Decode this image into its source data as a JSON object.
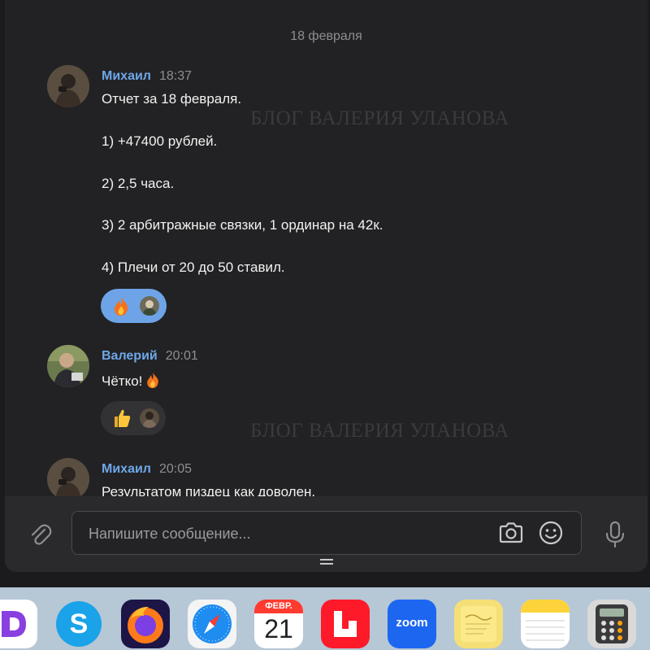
{
  "date_separator": "18 февраля",
  "messages": [
    {
      "author": "Михаил",
      "time": "18:37",
      "lines": [
        "Отчет за 18 февраля.",
        "1) +47400 рублей.",
        "2) 2,5 часа.",
        "3) 2 арбитражные связки, 1 ординар на 42к.",
        "4) Плечи от 20 до 50 ставил."
      ],
      "reaction": "fire-emoji"
    },
    {
      "author": "Валерий",
      "time": "20:01",
      "lines": [
        "Чётко!"
      ],
      "reaction": "thumbs-up-emoji"
    },
    {
      "author": "Михаил",
      "time": "20:05",
      "lines": [
        "Результатом пиздец как доволен."
      ]
    }
  ],
  "watermark": "БЛОГ ВАЛЕРИЯ УЛАНОВА",
  "composer": {
    "placeholder": "Напишите сообщение..."
  },
  "dock": {
    "calendar_month": "ФЕВР.",
    "calendar_day": "21",
    "zoom_label": "zoom",
    "icons": [
      "d-app-icon",
      "skype-icon",
      "firefox-icon",
      "safari-icon",
      "calendar-icon",
      "lightroom-icon",
      "zoom-icon",
      "stickies-icon",
      "notes-icon",
      "calculator-icon"
    ]
  },
  "colors": {
    "accent": "#6ea7e8",
    "background": "#222224",
    "reaction_active": "#6ea4e7"
  }
}
